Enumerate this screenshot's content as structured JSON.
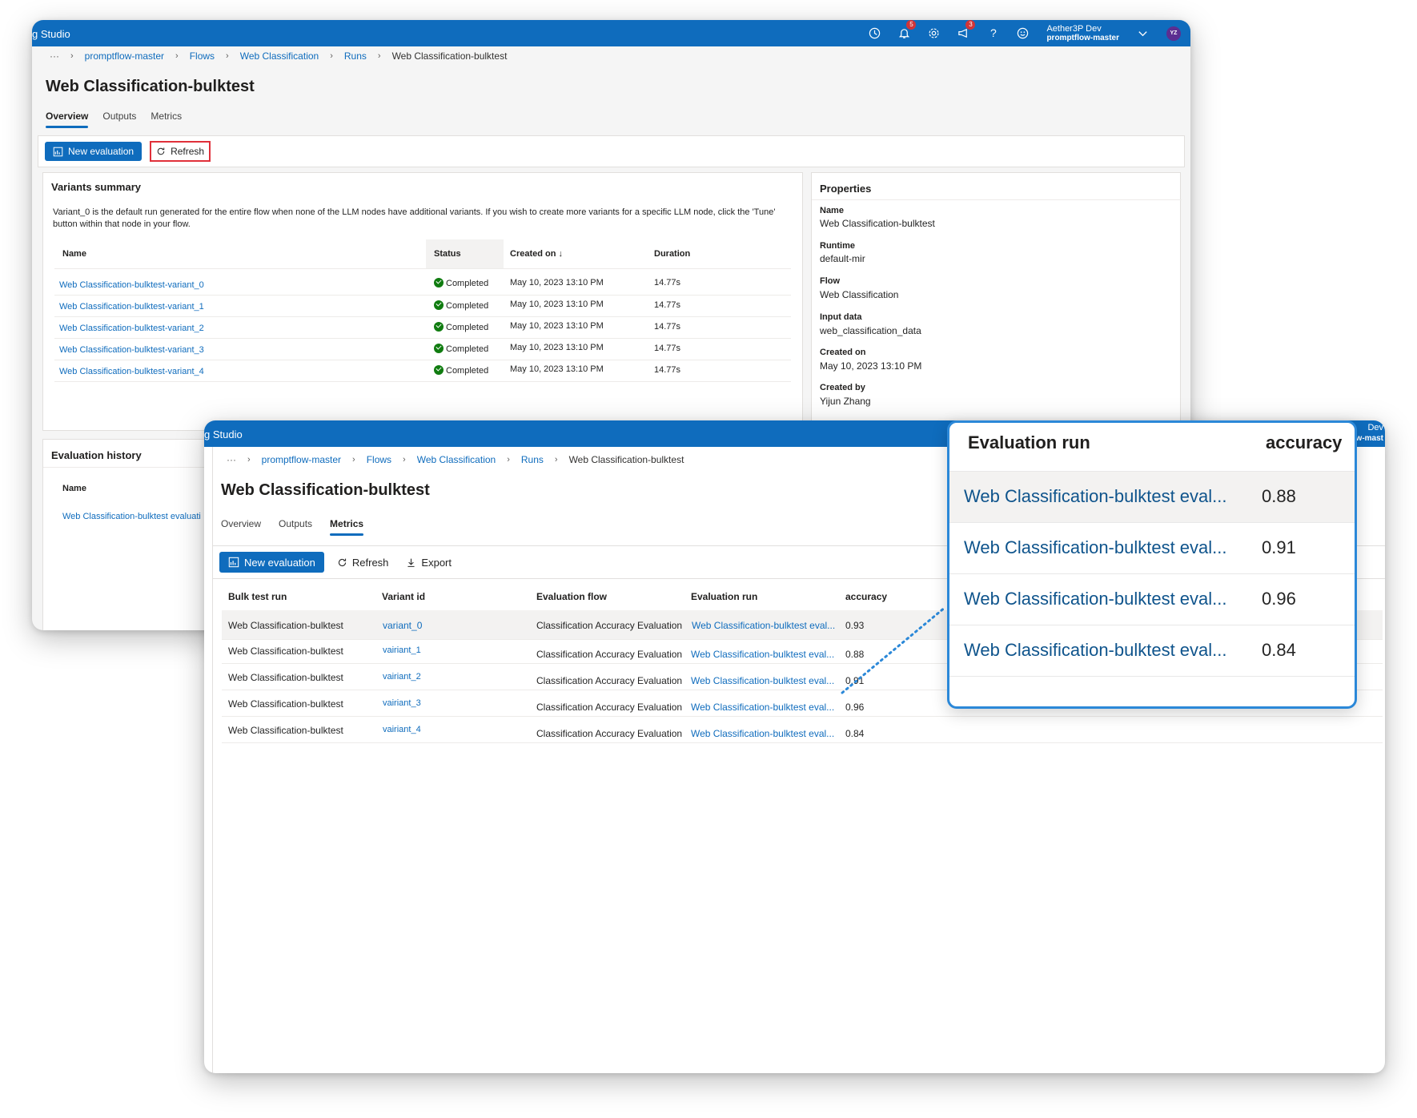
{
  "colors": {
    "brand": "#0f6cbd",
    "success": "#107c10",
    "badge": "#d13438",
    "highlight_outline": "#e0303a",
    "callout_border": "#2b88d8"
  },
  "window_back": {
    "app_title": "g Studio",
    "header_icons": [
      "clock-icon",
      "bell-icon",
      "gear-icon",
      "megaphone-icon",
      "help-icon",
      "smiley-icon",
      "chevron-down-icon"
    ],
    "notification_badge": "5",
    "announcement_badge": "3",
    "account": {
      "name": "Aether3P Dev",
      "workspace": "promptflow-master",
      "initials": "YZ"
    },
    "breadcrumb": {
      "more": "···",
      "items": [
        "promptflow-master",
        "Flows",
        "Web Classification",
        "Runs"
      ],
      "current": "Web Classification-bulktest"
    },
    "page_title": "Web Classification-bulktest",
    "tabs": [
      "Overview",
      "Outputs",
      "Metrics"
    ],
    "commands": {
      "new_evaluation": "New evaluation",
      "refresh": "Refresh"
    },
    "variants_summary": {
      "title": "Variants summary",
      "description": "Variant_0 is the default run generated for the entire flow when none of the LLM nodes have additional variants. If you wish to create more variants for a specific LLM node, click the 'Tune' button within that node in your flow.",
      "columns": [
        "Name",
        "Status",
        "Created on ↓",
        "Duration"
      ],
      "rows": [
        {
          "name": "Web Classification-bulktest-variant_0",
          "status": "Completed",
          "created": "May 10, 2023 13:10 PM",
          "duration": "14.77s"
        },
        {
          "name": "Web Classification-bulktest-variant_1",
          "status": "Completed",
          "created": "May 10, 2023 13:10 PM",
          "duration": "14.77s"
        },
        {
          "name": "Web Classification-bulktest-variant_2",
          "status": "Completed",
          "created": "May 10, 2023 13:10 PM",
          "duration": "14.77s"
        },
        {
          "name": "Web Classification-bulktest-variant_3",
          "status": "Completed",
          "created": "May 10, 2023 13:10 PM",
          "duration": "14.77s"
        },
        {
          "name": "Web Classification-bulktest-variant_4",
          "status": "Completed",
          "created": "May 10, 2023 13:10 PM",
          "duration": "14.77s"
        }
      ]
    },
    "properties": {
      "title": "Properties",
      "name_label": "Name",
      "name_value": "Web Classification-bulktest",
      "runtime_label": "Runtime",
      "runtime_value": "default-mir",
      "flow_label": "Flow",
      "flow_value": "Web Classification",
      "input_label": "Input data",
      "input_value": "web_classification_data",
      "created_label": "Created on",
      "created_value": "May 10, 2023 13:10 PM",
      "createdby_label": "Created by",
      "createdby_value": "Yijun Zhang"
    },
    "evaluation_history": {
      "title": "Evaluation history",
      "column": "Name",
      "row": "Web Classification-bulktest evaluati"
    }
  },
  "window_front": {
    "app_title": "g Studio",
    "account_partial": {
      "line1": "Dev",
      "line2": "w-mast"
    },
    "breadcrumb": {
      "more": "···",
      "items": [
        "promptflow-master",
        "Flows",
        "Web Classification",
        "Runs"
      ],
      "current": "Web Classification-bulktest"
    },
    "page_title": "Web Classification-bulktest",
    "tabs": [
      "Overview",
      "Outputs",
      "Metrics"
    ],
    "commands": {
      "new_evaluation": "New evaluation",
      "refresh": "Refresh",
      "export": "Export"
    },
    "metrics_table": {
      "columns": [
        "Bulk test run",
        "Variant id",
        "Evaluation flow",
        "Evaluation run",
        "accuracy"
      ],
      "rows": [
        {
          "run": "Web Classification-bulktest",
          "variant": "variant_0",
          "flow": "Classification Accuracy Evaluation",
          "eval_run": "Web Classification-bulktest eval...",
          "accuracy": "0.93"
        },
        {
          "run": "Web Classification-bulktest",
          "variant": "vairiant_1",
          "flow": "Classification Accuracy Evaluation",
          "eval_run": "Web Classification-bulktest eval...",
          "accuracy": "0.88"
        },
        {
          "run": "Web Classification-bulktest",
          "variant": "vairiant_2",
          "flow": "Classification Accuracy Evaluation",
          "eval_run": "Web Classification-bulktest eval...",
          "accuracy": "0.91"
        },
        {
          "run": "Web Classification-bulktest",
          "variant": "vairiant_3",
          "flow": "Classification Accuracy Evaluation",
          "eval_run": "Web Classification-bulktest eval...",
          "accuracy": "0.96"
        },
        {
          "run": "Web Classification-bulktest",
          "variant": "vairiant_4",
          "flow": "Classification Accuracy Evaluation",
          "eval_run": "Web Classification-bulktest eval...",
          "accuracy": "0.84"
        }
      ]
    }
  },
  "callout": {
    "columns": [
      "Evaluation run",
      "accuracy"
    ],
    "rows": [
      {
        "eval_run": "Web Classification-bulktest eval...",
        "accuracy": "0.88"
      },
      {
        "eval_run": "Web Classification-bulktest eval...",
        "accuracy": "0.91"
      },
      {
        "eval_run": "Web Classification-bulktest eval...",
        "accuracy": "0.96"
      },
      {
        "eval_run": "Web Classification-bulktest eval...",
        "accuracy": "0.84"
      }
    ]
  }
}
